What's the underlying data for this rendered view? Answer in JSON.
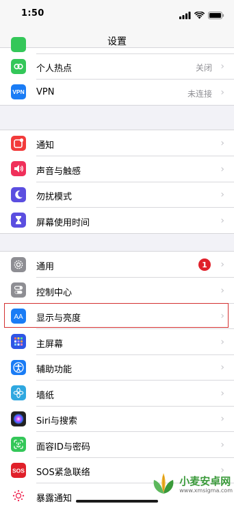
{
  "status_bar": {
    "time": "1:50"
  },
  "nav": {
    "title": "设置"
  },
  "colors": {
    "accent_highlight": "#d32f2f",
    "badge": "#e0202a"
  },
  "groups": [
    {
      "rows": [
        {
          "label": "个人热点",
          "value": "关闭",
          "icon": "hotspot-icon",
          "color": "#34c759"
        },
        {
          "label": "VPN",
          "value": "未连接",
          "icon": "vpn-icon",
          "color": "#1a7cf5"
        }
      ]
    },
    {
      "rows": [
        {
          "label": "通知",
          "icon": "notifications-icon",
          "color": "#f23b3b"
        },
        {
          "label": "声音与触感",
          "icon": "sound-icon",
          "color": "#f0305a"
        },
        {
          "label": "勿扰模式",
          "icon": "moon-icon",
          "color": "#5b4ee0"
        },
        {
          "label": "屏幕使用时间",
          "icon": "hourglass-icon",
          "color": "#5b4ee0"
        }
      ]
    },
    {
      "rows": [
        {
          "label": "通用",
          "badge": "1",
          "icon": "gear-icon",
          "color": "#8e8e93"
        },
        {
          "label": "控制中心",
          "icon": "toggles-icon",
          "color": "#8e8e93"
        },
        {
          "label": "显示与亮度",
          "icon": "display-brightness-icon",
          "color": "#1a7cf5"
        },
        {
          "label": "主屏幕",
          "icon": "home-screen-icon",
          "color": "#2f56e6"
        },
        {
          "label": "辅助功能",
          "icon": "accessibility-icon",
          "color": "#1a7cf5"
        },
        {
          "label": "墙纸",
          "icon": "wallpaper-icon",
          "color": "#2fa8e0"
        },
        {
          "label": "Siri与搜索",
          "icon": "siri-icon",
          "color": "#222222"
        },
        {
          "label": "面容ID与密码",
          "icon": "face-id-icon",
          "color": "#34c759"
        },
        {
          "label": "SOS紧急联络",
          "icon": "sos-icon",
          "color": "#e0202a"
        },
        {
          "label": "暴露通知",
          "icon": "exposure-icon",
          "color": "#ffffff"
        }
      ]
    }
  ],
  "watermark": {
    "name": "小麦安卓网",
    "url": "www.xmsigma.com"
  }
}
